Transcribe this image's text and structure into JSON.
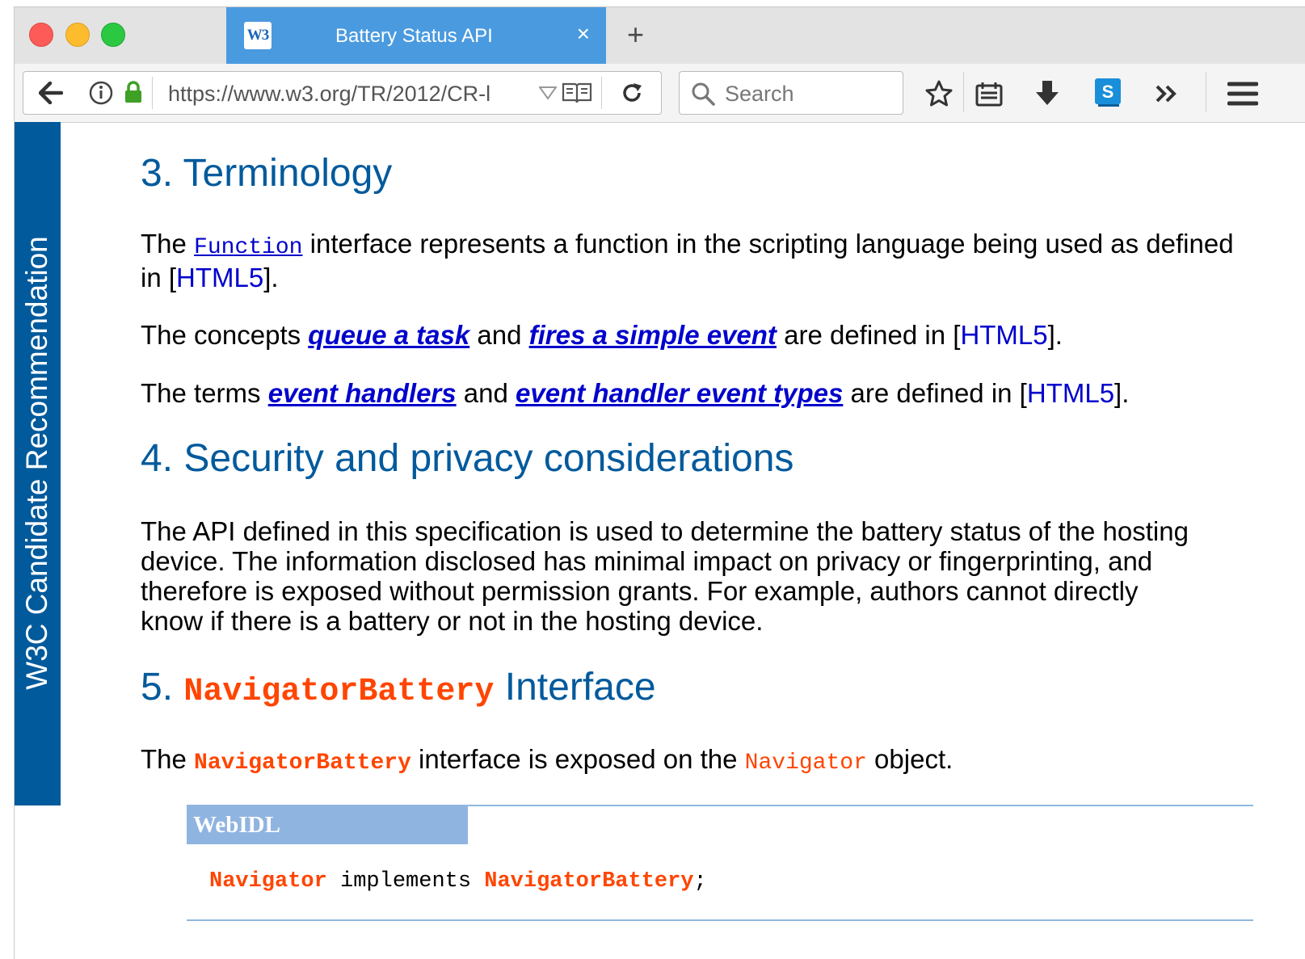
{
  "browser": {
    "tab": {
      "favicon": "W3",
      "title": "Battery Status API",
      "close": "×"
    },
    "new_tab": "+",
    "url": "https://www.w3.org/TR/2012/CR-l",
    "search_placeholder": "Search"
  },
  "sidebar": {
    "label": "W3C Candidate Recommendation"
  },
  "sections": {
    "terminology": {
      "heading": "3. Terminology",
      "p1": {
        "pre": "The ",
        "code": "Function",
        "post": " interface represents a function in the scripting language being used as defined in [",
        "ref": "HTML5",
        "end": "]."
      },
      "p2": {
        "pre": "The concepts ",
        "link1": "queue a task",
        "mid": " and ",
        "link2": "fires a simple event",
        "post": " are defined in [",
        "ref": "HTML5",
        "end": "]."
      },
      "p3": {
        "pre": "The terms ",
        "link1": "event handlers",
        "mid": " and ",
        "link2": "event handler event types",
        "post": " are defined in [",
        "ref": "HTML5",
        "end": "]."
      }
    },
    "security": {
      "heading": "4. Security and privacy considerations",
      "p1": "The API defined in this specification is used to determine the battery status of the hosting device. The information disclosed has minimal impact on privacy or fingerprinting, and therefore is exposed without permission grants. For example, authors cannot directly know if there is a battery or not in the hosting device."
    },
    "navigator": {
      "heading_pre": "5. ",
      "heading_code": "NavigatorBattery",
      "heading_post": " Interface",
      "p1": {
        "pre": "The ",
        "code1": "NavigatorBattery",
        "mid": " interface is exposed on the ",
        "code2": "Navigator",
        "post": " object."
      },
      "webidl": {
        "label": "WebIDL",
        "code1": "Navigator",
        "mid": " implements ",
        "code2": "NavigatorBattery",
        "end": ";"
      }
    }
  }
}
